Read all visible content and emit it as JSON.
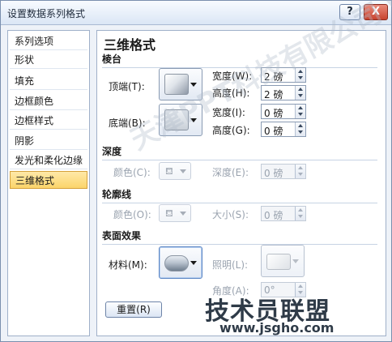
{
  "window": {
    "title": "设置数据系列格式",
    "help": "?",
    "close": "X"
  },
  "sidebar": {
    "items": [
      {
        "label": "系列选项"
      },
      {
        "label": "形状"
      },
      {
        "label": "填充"
      },
      {
        "label": "边框颜色"
      },
      {
        "label": "边框样式"
      },
      {
        "label": "阴影"
      },
      {
        "label": "发光和柔化边缘"
      },
      {
        "label": "三维格式",
        "selected": true
      }
    ]
  },
  "panel": {
    "heading": "三维格式",
    "bevel": {
      "section": "棱台",
      "top_label": "顶端(T):",
      "bottom_label": "底端(B):",
      "top_width_label": "宽度(W):",
      "top_width_value": "2 磅",
      "top_height_label": "高度(H):",
      "top_height_value": "2 磅",
      "bottom_width_label": "宽度(I):",
      "bottom_width_value": "0 磅",
      "bottom_height_label": "高度(G):",
      "bottom_height_value": "0 磅"
    },
    "depth": {
      "section": "深度",
      "color_label": "颜色(C):",
      "depth_label": "深度(E):",
      "depth_value": "0 磅"
    },
    "contour": {
      "section": "轮廓线",
      "color_label": "颜色(O):",
      "size_label": "大小(S):",
      "size_value": "0 磅"
    },
    "surface": {
      "section": "表面效果",
      "material_label": "材料(M):",
      "lighting_label": "照明(L):",
      "angle_label": "角度(A):",
      "angle_value": "0°"
    },
    "reset_label": "重置(R)"
  },
  "watermark": {
    "diagonal": "天津PPT科技有限公司 www.pppt.com.cn",
    "brand": "技术员联盟",
    "url": "www.jsgho.com"
  },
  "colors": {
    "selected_bg": "#fbd46a",
    "accent_border": "#5b86c4",
    "title_bg": "#dbe6f5"
  }
}
